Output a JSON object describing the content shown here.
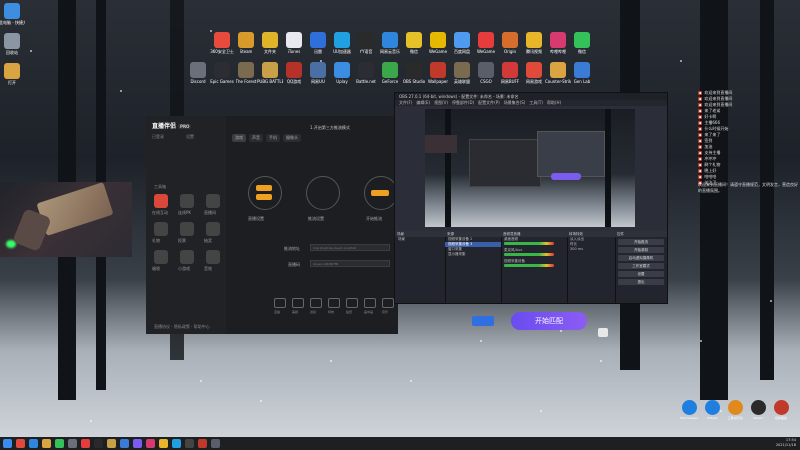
{
  "desktop": {
    "icons_left": [
      {
        "label": "此电脑 - 快捷方式",
        "color": "#3d8de0"
      },
      {
        "label": "回收站",
        "color": "#8a96a3"
      },
      {
        "label": "打开",
        "color": "#d9a441"
      }
    ],
    "icons_row1": [
      {
        "label": "360安全卫士",
        "color": "#e84b3c"
      },
      {
        "label": "Steam",
        "color": "#d89a2a"
      },
      {
        "label": "文件夹",
        "color": "#e0b429"
      },
      {
        "label": "iTunes",
        "color": "#e8e8f0"
      },
      {
        "label": "迅雷",
        "color": "#2e6fd9"
      },
      {
        "label": "UU加速器",
        "color": "#20a0e0"
      },
      {
        "label": "YY语音",
        "color": "#2a2a2a"
      },
      {
        "label": "网易云音乐",
        "color": "#2e86de"
      },
      {
        "label": "微信",
        "color": "#e6c229"
      },
      {
        "label": "WeGame",
        "color": "#e5b900"
      },
      {
        "label": "百度网盘",
        "color": "#4e9bf0"
      },
      {
        "label": "WeGame",
        "color": "#e63c3c"
      },
      {
        "label": "Origin",
        "color": "#d66d2c"
      },
      {
        "label": "腾讯视频",
        "color": "#e8b62b"
      },
      {
        "label": "哔哩哔哩",
        "color": "#d63a6e"
      },
      {
        "label": "微信",
        "color": "#35c15a"
      }
    ],
    "icons_row2": [
      {
        "label": "Discord",
        "color": "#6b6f7a"
      },
      {
        "label": "Epic Games",
        "color": "#2b2d33"
      },
      {
        "label": "The Forest",
        "color": "#7a6a50"
      },
      {
        "label": "PUBG BATTLEGR",
        "color": "#c8a048"
      },
      {
        "label": "QQ游戏",
        "color": "#b5312a"
      },
      {
        "label": "网易UU",
        "color": "#4a6fa5"
      },
      {
        "label": "Uplay",
        "color": "#3a8de0"
      },
      {
        "label": "Battle.net",
        "color": "#2b2d33"
      },
      {
        "label": "GeForce",
        "color": "#3aa84a"
      },
      {
        "label": "OBS Studio",
        "color": "#2a2a2a"
      },
      {
        "label": "Wallpaper",
        "color": "#c0392b"
      },
      {
        "label": "英雄联盟",
        "color": "#7a6b50"
      },
      {
        "label": "CSGO",
        "color": "#5a5e6a"
      },
      {
        "label": "网易BUFF",
        "color": "#d23a3a"
      },
      {
        "label": "网易游戏",
        "color": "#e04a3a"
      },
      {
        "label": "Counter-Strike",
        "color": "#d9a441"
      },
      {
        "label": "Gen Lab",
        "color": "#3a7bd5"
      }
    ]
  },
  "app": {
    "name": "直播伴侣",
    "version": "PRO",
    "tabs": [
      "游戏",
      "声音",
      "手机",
      "摄像头"
    ],
    "link1": "已登录",
    "link2": "设置",
    "center_title": "1.开启第三方推流模式",
    "step_labels": [
      "直播设置",
      "推流设置",
      "开始推流"
    ],
    "field1_label": "推流地址",
    "field1_value": "rtmp://push.live.douyin.com/third",
    "field2_label": "直播码",
    "field2_value": "stream-123456789",
    "sidebar_section": "工具箱",
    "sidebar_tiles": [
      {
        "label": "在线互动",
        "color": "#d9483b"
      },
      {
        "label": "连线PK",
        "color": "#444"
      },
      {
        "label": "直播间",
        "color": "#444"
      },
      {
        "label": "礼物",
        "color": "#444"
      },
      {
        "label": "投票",
        "color": "#444"
      },
      {
        "label": "抽奖",
        "color": "#444"
      },
      {
        "label": "福袋",
        "color": "#444"
      },
      {
        "label": "小游戏",
        "color": "#444"
      },
      {
        "label": "音效",
        "color": "#444"
      }
    ],
    "bottom_bar": [
      "直播",
      "美颜",
      "滤镜",
      "特效",
      "贴纸",
      "画中画",
      "音乐"
    ],
    "footer_text": "直播协议 · 隐私政策 · 帮助中心"
  },
  "obs": {
    "title": "OBS 27.0.1 (64-bit, windows) - 配置文件: 未命名 - 场景: 未命名",
    "menu": [
      "文件(F)",
      "编辑(E)",
      "视图(V)",
      "停靠部件(D)",
      "配置文件(P)",
      "场景集合(S)",
      "工具(T)",
      "帮助(H)"
    ],
    "panels": {
      "scenes": "场景",
      "sources": "来源",
      "mixer": "音频混音器",
      "transitions": "转场特效",
      "controls": "控件"
    },
    "scene_items": [
      "场景"
    ],
    "source_items": [
      "视频采集设备 2",
      "视频采集设备 3",
      "窗口采集",
      "显示器采集"
    ],
    "mixer_items": [
      "桌面音频",
      "麦克风/Aux",
      "视频采集设备"
    ],
    "transition_items": [
      "淡入淡出",
      "时长",
      "300 ms"
    ],
    "control_buttons": [
      "开始推流",
      "开始录制",
      "启动虚拟摄像机",
      "工作室模式",
      "设置",
      "退出"
    ]
  },
  "chat": {
    "rows": [
      "欢迎来到直播间",
      "欢迎来到直播间",
      "欢迎来到直播间",
      "来了老弟",
      "好卡啊",
      "主播666",
      "什么时候开始",
      "来了来了",
      "签到",
      "加油",
      "支持主播",
      "冲冲冲",
      "刷个礼物",
      "晚上好",
      "哈哈哈",
      "关注了"
    ],
    "notice": "欢迎来到直播间！请遵守直播规范，文明发言，营造良好的直播氛围。"
  },
  "match_button": "开始匹配",
  "taskbar": {
    "clock_time": "17:54",
    "clock_date": "2021/11/18",
    "tray_icons": [
      {
        "label": "TeamViewer",
        "color": "#1e7fe0"
      },
      {
        "label": "ToDesk",
        "color": "#1e7fe0"
      },
      {
        "label": "三角洲行动",
        "color": "#e08a1e"
      },
      {
        "label": "Steam",
        "color": "#2a2a2a"
      },
      {
        "label": "控制面板",
        "color": "#c0392b"
      }
    ]
  }
}
